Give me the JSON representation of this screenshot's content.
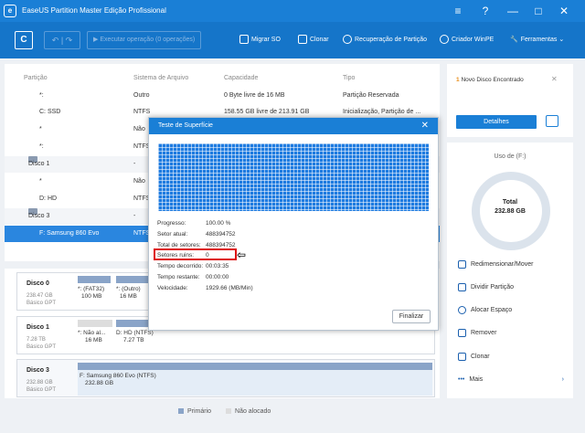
{
  "app": {
    "title": "EaseUS Partition Master Edição Profissional"
  },
  "toolbar": {
    "run_operation": "Executar operação (0 operações)",
    "migrate_os": "Migrar SO",
    "clone": "Clonar",
    "partition_recovery": "Recuperação de Partição",
    "winpe_creator": "Criador WinPE",
    "tools": "Ferramentas"
  },
  "table": {
    "headers": {
      "partition": "Partição",
      "fs": "Sistema de Arquivo",
      "capacity": "Capacidade",
      "type": "Tipo"
    },
    "rows": [
      {
        "name": "*:",
        "fs": "Outro",
        "cap": "0 Byte livre de 16 MB",
        "type": "Partição Reservada"
      },
      {
        "name": "C: SSD",
        "fs": "NTFS",
        "cap": "158.55 GB livre de 213.91 GB",
        "type": "Inicialização, Partição de ..."
      },
      {
        "name": "*",
        "fs": "Não",
        "cap": "",
        "type": ""
      },
      {
        "name": "*:",
        "fs": "NTFS",
        "cap": "",
        "type": ""
      },
      {
        "name": "Disco 1",
        "fs": "-",
        "cap": "",
        "type": ""
      },
      {
        "name": "*",
        "fs": "Não",
        "cap": "",
        "type": ""
      },
      {
        "name": "D: HD",
        "fs": "NTFS",
        "cap": "",
        "type": ""
      },
      {
        "name": "Disco 3",
        "fs": "-",
        "cap": "",
        "type": ""
      },
      {
        "name": "F: Samsung 860 Evo",
        "fs": "NTFS",
        "cap": "",
        "type": ""
      }
    ]
  },
  "disks": [
    {
      "name": "Disco 0",
      "size": "238.47 GB",
      "style": "Básico GPT",
      "parts": [
        {
          "label": "*: (FAT32)",
          "size": "100 MB"
        },
        {
          "label": "*: (Outro)",
          "size": "16 MB"
        }
      ]
    },
    {
      "name": "Disco 1",
      "size": "7.28 TB",
      "style": "Básico GPT",
      "parts": [
        {
          "label": "*: Não al...",
          "size": "16 MB"
        },
        {
          "label": "D: HD (NTFS)",
          "size": "7.27 TB"
        }
      ]
    },
    {
      "name": "Disco 3",
      "size": "232.88 GB",
      "style": "Básico GPT",
      "parts": [
        {
          "label": "F: Samsung 860 Evo (NTFS)",
          "size": "232.88 GB"
        }
      ]
    }
  ],
  "legend": {
    "primary": "Primário",
    "unallocated": "Não alocado"
  },
  "right": {
    "new_disk_count": "1",
    "new_disk_text": "Novo Disco Encontrado",
    "details_btn": "Detalhes",
    "usage_title": "Uso de (F:)",
    "total_label": "Total",
    "total_value": "232.88 GB",
    "actions": [
      "Redimensionar/Mover",
      "Dividir Partição",
      "Alocar Espaço",
      "Remover",
      "Clonar",
      "Mais"
    ]
  },
  "dialog": {
    "title": "Teste de Superfície",
    "stats": [
      {
        "label": "Progresso:",
        "value": "100.00 %"
      },
      {
        "label": "Setor atual:",
        "value": "488394752"
      },
      {
        "label": "Total de setores:",
        "value": "488394752"
      },
      {
        "label": "Setores ruins:",
        "value": "0"
      },
      {
        "label": "Tempo decorrido:",
        "value": "00:03:35"
      },
      {
        "label": "Tempo restante:",
        "value": "00:00:00"
      },
      {
        "label": "Velocidade:",
        "value": "1929.66 (MB/Min)"
      }
    ],
    "finish": "Finalizar"
  },
  "colors": {
    "accent": "#1a7fd6",
    "toolbar": "#1575c9",
    "selected_row": "#2a86df",
    "bad_highlight": "#d11111"
  }
}
